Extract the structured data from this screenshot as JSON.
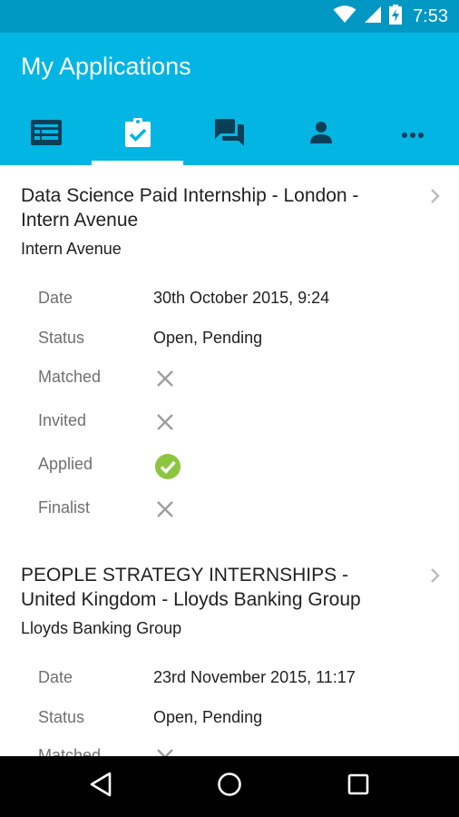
{
  "status_bar": {
    "time": "7:53",
    "icons": [
      "wifi-icon",
      "signal-icon",
      "battery-charging-icon"
    ]
  },
  "app_bar": {
    "title": "My Applications",
    "tabs": [
      {
        "icon": "list-icon",
        "active": false
      },
      {
        "icon": "clipboard-check-icon",
        "active": true
      },
      {
        "icon": "chat-icon",
        "active": false
      },
      {
        "icon": "person-icon",
        "active": false
      },
      {
        "icon": "more-horizontal-icon",
        "active": false
      }
    ]
  },
  "applications": [
    {
      "title": "Data Science Paid Internship - London - Intern Avenue",
      "title_line1": "Data Science Paid Internship - London -",
      "title_line2": "Intern Avenue",
      "company": "Intern Avenue",
      "date_label": "Date",
      "date": "30th October 2015, 9:24",
      "status_label": "Status",
      "status": "Open, Pending",
      "stages": [
        {
          "label": "Matched",
          "done": false
        },
        {
          "label": "Invited",
          "done": false
        },
        {
          "label": "Applied",
          "done": true
        },
        {
          "label": "Finalist",
          "done": false
        }
      ]
    },
    {
      "title": "PEOPLE STRATEGY INTERNSHIPS - United Kingdom - Lloyds Banking Group",
      "title_line1": "PEOPLE STRATEGY INTERNSHIPS -",
      "title_line2": "United Kingdom - Lloyds Banking Group",
      "company": "Lloyds Banking Group",
      "date_label": "Date",
      "date": "23rd November 2015, 11:17",
      "status_label": "Status",
      "status": "Open, Pending",
      "stages": [
        {
          "label": "Matched",
          "done": false
        }
      ]
    }
  ],
  "nav_bar": {
    "buttons": [
      "back-icon",
      "home-icon",
      "recents-icon"
    ]
  },
  "colors": {
    "primary": "#03b5e3",
    "status_bar": "#0197c3",
    "check_green": "#8cc63f",
    "cross_gray": "#9e9e9e"
  }
}
